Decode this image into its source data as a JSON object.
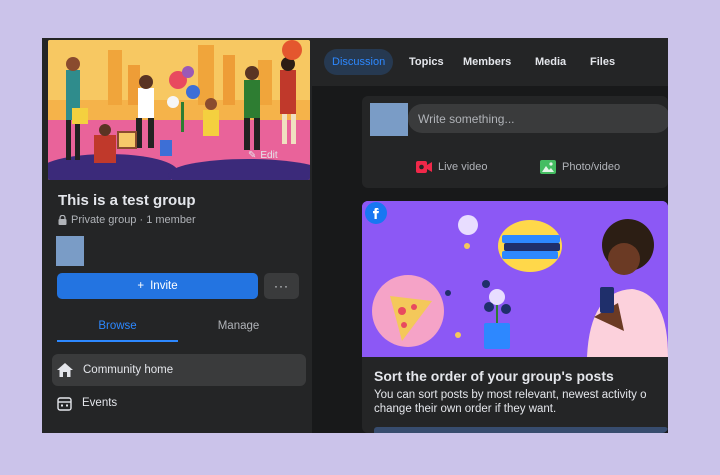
{
  "sidebar": {
    "edit_label": "Edit",
    "group_title": "This is a test group",
    "group_meta": "Private group · 1 member",
    "invite_label": "Invite",
    "more_label": "···",
    "tabs": {
      "browse": "Browse",
      "manage": "Manage"
    },
    "items": [
      {
        "label": "Community home"
      },
      {
        "label": "Events"
      }
    ]
  },
  "nav": {
    "tabs": [
      {
        "label": "Discussion"
      },
      {
        "label": "Topics"
      },
      {
        "label": "Members"
      },
      {
        "label": "Media"
      },
      {
        "label": "Files"
      }
    ]
  },
  "composer": {
    "placeholder": "Write something...",
    "live_label": "Live video",
    "photo_label": "Photo/video"
  },
  "promo": {
    "title": "Sort the order of your group's posts",
    "body": "You can sort posts by most relevant, newest activity o change their own order if they want."
  },
  "colors": {
    "accent": "#2d88ff",
    "button": "#2374e1",
    "promo_bg": "#8c58f5",
    "page_bg": "#cbc3ea"
  }
}
